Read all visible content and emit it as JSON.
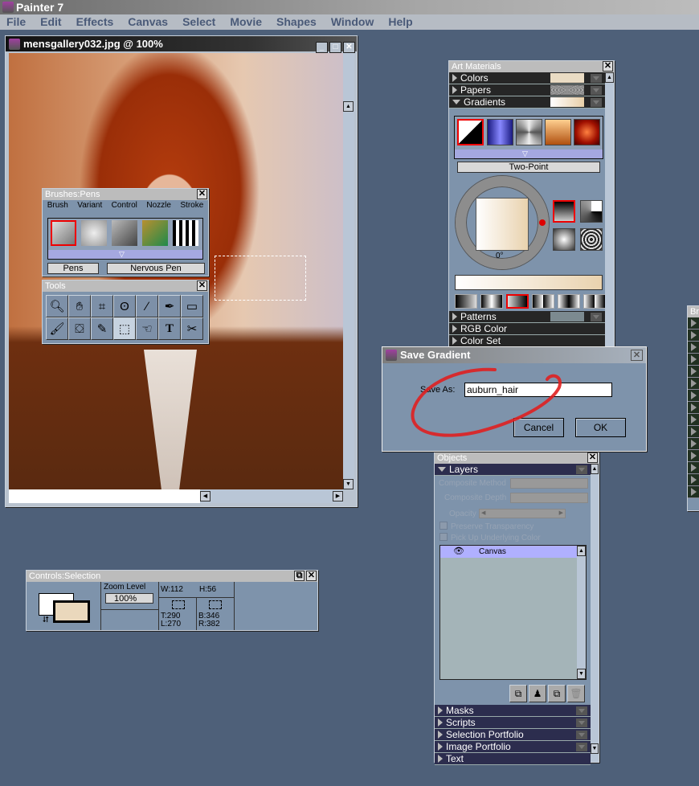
{
  "app": {
    "title": "Painter 7",
    "menu": [
      "File",
      "Edit",
      "Effects",
      "Canvas",
      "Select",
      "Movie",
      "Shapes",
      "Window",
      "Help"
    ]
  },
  "document": {
    "title": "mensgallery032.jpg @ 100%"
  },
  "brushes": {
    "title": "Brushes:Pens",
    "menu": [
      "Brush",
      "Variant",
      "Control",
      "Nozzle",
      "Stroke"
    ],
    "category": "Pens",
    "variant": "Nervous Pen"
  },
  "tools": {
    "title": "Tools",
    "items": [
      "magnifier-icon",
      "grabber-icon",
      "crop-icon",
      "lasso-icon",
      "brush-icon",
      "pen-icon",
      "rectangle-shape-icon",
      "dropper-brush-icon",
      "paint-bucket-icon",
      "dropper-icon",
      "rectangular-selection-icon",
      "layer-adjuster-icon",
      "text-icon",
      "scissors-icon"
    ],
    "selected": "rectangular-selection-icon"
  },
  "art_materials": {
    "title": "Art Materials",
    "sections_top": [
      "Colors",
      "Papers",
      "Gradients"
    ],
    "gradient_type": "Two-Point",
    "angle": "0°",
    "sections_bottom": [
      "Patterns",
      "RGB Color",
      "Color Set"
    ]
  },
  "save_gradient": {
    "title": "Save Gradient",
    "label": "Save As:",
    "value": "auburn_hair",
    "cancel": "Cancel",
    "ok": "OK",
    "annotation_color": "#e02020"
  },
  "objects": {
    "title": "Objects",
    "section": "Layers",
    "composite_method": "Composite Method",
    "composite_depth": "Composite Depth",
    "opacity": "Opacity",
    "preserve": "Preserve Transparency",
    "pickup": "Pick Up Underlying Color",
    "layer": "Canvas",
    "sections_bottom": [
      "Masks",
      "Scripts",
      "Selection Portfolio",
      "Image Portfolio",
      "Text"
    ]
  },
  "controls": {
    "title": "Controls:Selection",
    "zoom_label": "Zoom Level",
    "zoom_value": "100%",
    "w": "W:112",
    "h": "H:56",
    "t": "T:290",
    "l": "L:270",
    "b": "B:346",
    "r": "R:382"
  },
  "right_panel": {
    "title": "Br"
  }
}
